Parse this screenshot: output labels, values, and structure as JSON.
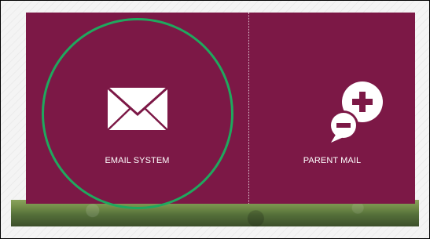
{
  "tiles": [
    {
      "label": "EMAIL SYSTEM",
      "icon": "envelope-icon"
    },
    {
      "label": "PARENT MAIL",
      "icon": "speech-bubbles-plus-minus-icon"
    }
  ],
  "colors": {
    "panel": "#7c1846",
    "highlight_ring": "#1fa85e",
    "text": "#ffffff"
  }
}
